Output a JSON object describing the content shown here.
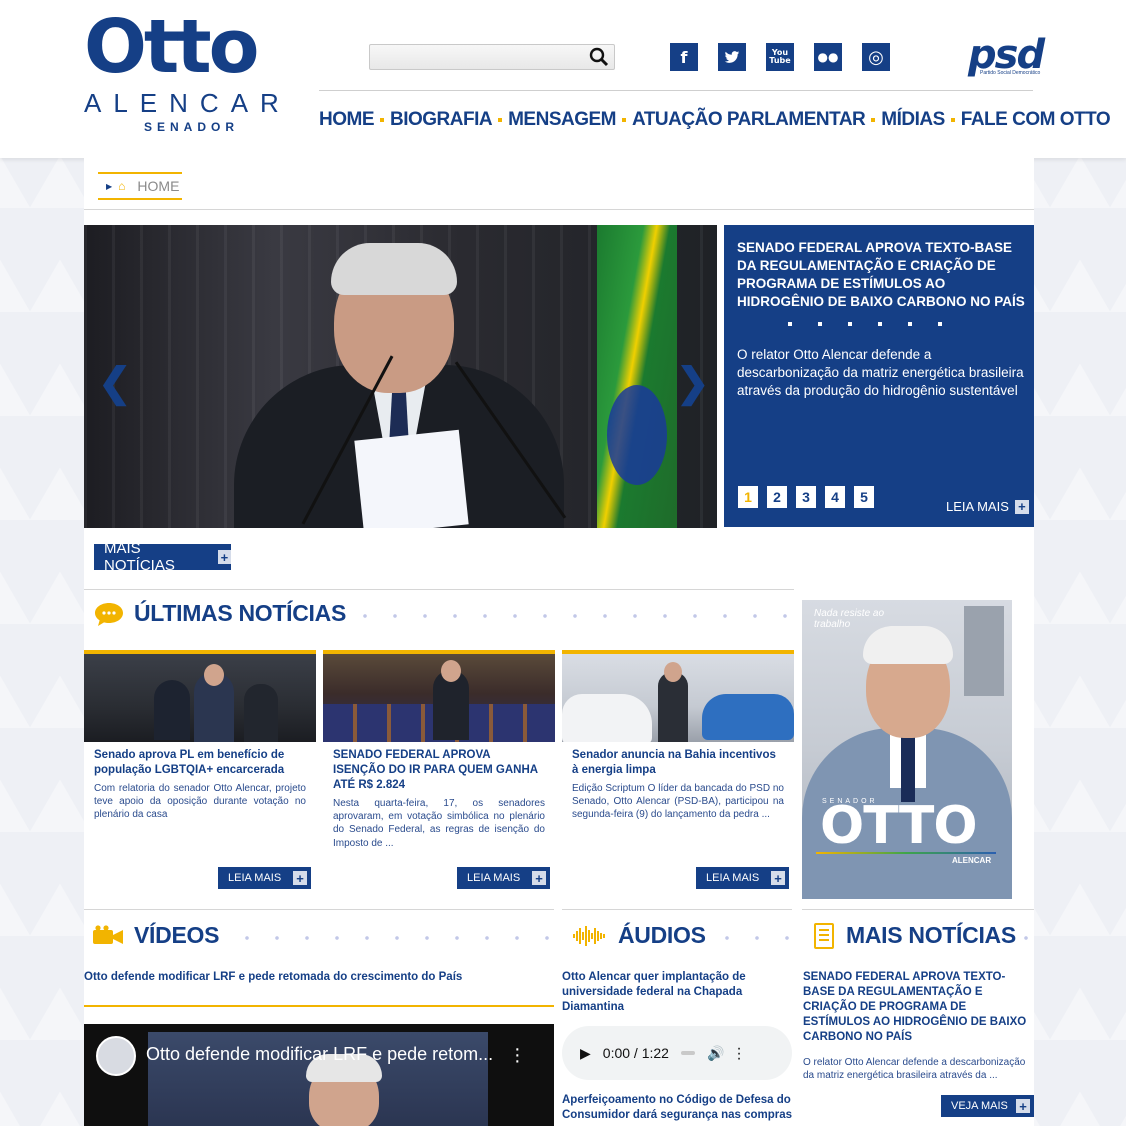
{
  "brand": {
    "name": "Otto",
    "surname": "ALENCAR",
    "role": "SENADOR",
    "colors": {
      "primary": "#153f86",
      "accent": "#f2b400"
    }
  },
  "search": {
    "placeholder": "",
    "icon": "search-icon"
  },
  "social": [
    {
      "name": "facebook-icon",
      "glyph": "f"
    },
    {
      "name": "twitter-icon",
      "glyph": "🐦"
    },
    {
      "name": "youtube-icon",
      "glyph": "You\nTube"
    },
    {
      "name": "flickr-icon",
      "glyph": "●●"
    },
    {
      "name": "instagram-icon",
      "glyph": "◎"
    }
  ],
  "party": {
    "logo_text": "psd",
    "subtitle": "Partido Social Democrático"
  },
  "nav": [
    {
      "label": "HOME"
    },
    {
      "label": "BIOGRAFIA"
    },
    {
      "label": "MENSAGEM"
    },
    {
      "label": "ATUAÇÃO PARLAMENTAR"
    },
    {
      "label": "MÍDIAS"
    },
    {
      "label": "FALE COM OTTO"
    }
  ],
  "breadcrumb": {
    "current": "HOME"
  },
  "slider": {
    "title": "SENADO FEDERAL APROVA TEXTO-BASE DA REGULAMENTAÇÃO E CRIAÇÃO DE PROGRAMA DE ESTÍMULOS AO HIDROGÊNIO DE BAIXO CARBONO NO PAÍS",
    "description": "O relator Otto Alencar defende a descarbonização da matriz energética brasileira através da produção do hidrogênio sustentável",
    "pages": [
      "1",
      "2",
      "3",
      "4",
      "5"
    ],
    "active_page": "1",
    "more_label": "LEIA MAIS",
    "prev_glyph": "❮",
    "next_glyph": "❯"
  },
  "more_news_button": "MAIS NOTÍCIAS",
  "latest": {
    "title": "ÚLTIMAS NOTÍCIAS",
    "items": [
      {
        "title": "Senado aprova PL em benefício de população LGBTQIA+ encarcerada",
        "text": "Com relatoria do senador Otto Alencar, projeto teve apoio da oposição durante votação no plenário da casa",
        "button": "LEIA MAIS"
      },
      {
        "title": "SENADO FEDERAL APROVA ISENÇÃO DO IR PARA QUEM GANHA ATÉ R$ 2.824",
        "text": "Nesta quarta-feira, 17, os senadores aprovaram, em votação simbólica no plenário do Senado Federal, as regras de isenção do Imposto de ...",
        "button": "LEIA MAIS"
      },
      {
        "title": "Senador anuncia na Bahia incentivos à energia limpa",
        "text": "Edição Scriptum O líder da bancada do PSD no Senado, Otto Alencar (PSD-BA), participou na segunda-feira (9) do lançamento da pedra ...",
        "button": "LEIA MAIS"
      }
    ]
  },
  "ad": {
    "slogan": "Nada resiste ao trabalho",
    "senador": "SENADOR",
    "name": "OTTO",
    "surname": "ALENCAR"
  },
  "videos": {
    "title": "VÍDEOS",
    "item_title": "Otto defende modificar LRF e pede retomada do crescimento do País",
    "player_title": "Otto defende modificar LRF e pede retom..."
  },
  "audios": {
    "title": "ÁUDIOS",
    "item1": "Otto Alencar quer implantação de universidade federal na Chapada Diamantina",
    "time": "0:00 / 1:22",
    "item2": "Aperfeiçoamento no Código de Defesa do Consumidor dará segurança nas compras"
  },
  "more_news": {
    "title": "MAIS NOTÍCIAS",
    "item_title": "SENADO FEDERAL APROVA TEXTO-BASE DA REGULAMENTAÇÃO E CRIAÇÃO DE PROGRAMA DE ESTÍMULOS AO HIDROGÊNIO DE BAIXO CARBONO NO PAÍS",
    "item_text": "O relator Otto Alencar defende a descarbonização da matriz energética brasileira através da ...",
    "button": "VEJA MAIS"
  }
}
